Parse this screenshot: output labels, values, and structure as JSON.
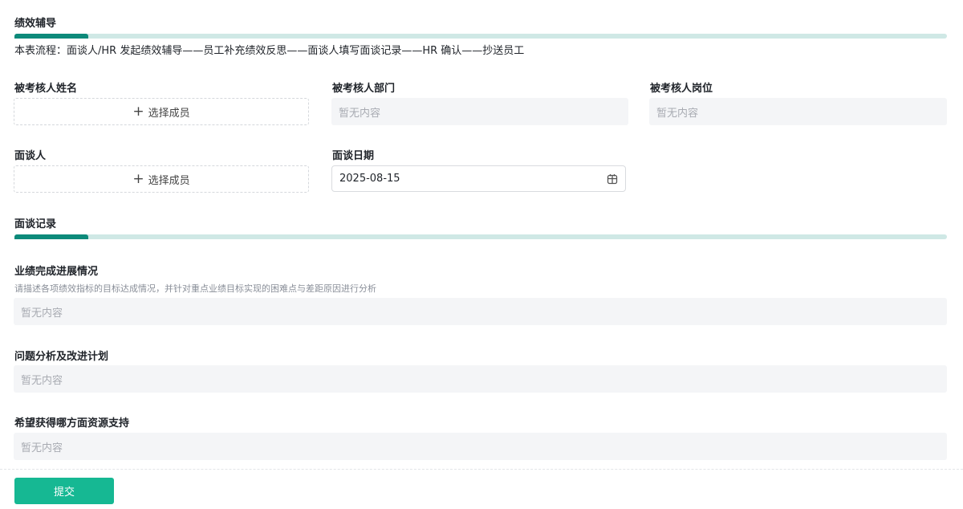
{
  "section1": {
    "title": "绩效辅导",
    "flow": "本表流程：面谈人/HR 发起绩效辅导——员工补充绩效反思——面谈人填写面谈记录——HR 确认——抄送员工"
  },
  "fields": {
    "name": {
      "label": "被考核人姓名",
      "button": "选择成员"
    },
    "dept": {
      "label": "被考核人部门",
      "placeholder": "暂无内容"
    },
    "post": {
      "label": "被考核人岗位",
      "placeholder": "暂无内容"
    },
    "interviewer": {
      "label": "面谈人",
      "button": "选择成员"
    },
    "date": {
      "label": "面谈日期",
      "value": "2025-08-15"
    }
  },
  "section2": {
    "title": "面谈记录"
  },
  "records": [
    {
      "label": "业绩完成进展情况",
      "hint": "请描述各项绩效指标的目标达成情况，并针对重点业绩目标实现的困难点与差距原因进行分析",
      "placeholder": "暂无内容"
    },
    {
      "label": "问题分析及改进计划",
      "placeholder": "暂无内容"
    },
    {
      "label": "希望获得哪方面资源支持",
      "placeholder": "暂无内容"
    }
  ],
  "submit": "提交"
}
